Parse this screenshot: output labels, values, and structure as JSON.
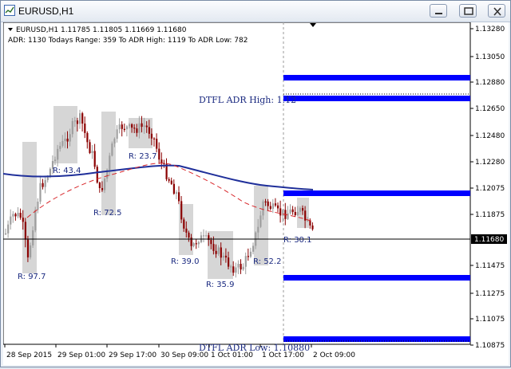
{
  "window": {
    "title": "EURUSD,H1"
  },
  "chart_data": {
    "type": "candlestick",
    "symbol": "EURUSD",
    "timeframe": "H1",
    "info_line": "EURUSD,H1  1.11785 1.11805 1.11669 1.11680",
    "adr_line": "ADR: 1130  Todays Range: 359  To ADR High: 1119  To ADR Low: 782",
    "current_price": "1.11680",
    "y_ticks": [
      "1.13280",
      "1.13050",
      "1.12880",
      "1.12650",
      "1.12480",
      "1.12280",
      "1.12075",
      "1.11875",
      "1.11680",
      "1.11475",
      "1.11275",
      "1.11075",
      "1.10875"
    ],
    "x_ticks": [
      "28 Sep 2015",
      "29 Sep 01:00",
      "29 Sep 17:00",
      "30 Sep 09:00",
      "1 Oct 01:00",
      "1 Oct 17:00",
      "2 Oct 09:00"
    ],
    "range_labels": [
      "R: 97.7",
      "R: 43.4",
      "R: 72.5",
      "R: 23.7",
      "R: 39.0",
      "R: 35.9",
      "R: 52.2",
      "R: 30.1"
    ],
    "adr_high_label": "DTFL ADR High: 1.12",
    "adr_low_label": "DTFL ADR Low: 1.10880",
    "colors": {
      "bull": "#9e9e9e",
      "bear": "#8b0000",
      "blue_ma": "#1f2f9a",
      "red_ma": "#d8262a",
      "level_bar": "#0000ff",
      "text": "#1b2a80"
    }
  }
}
